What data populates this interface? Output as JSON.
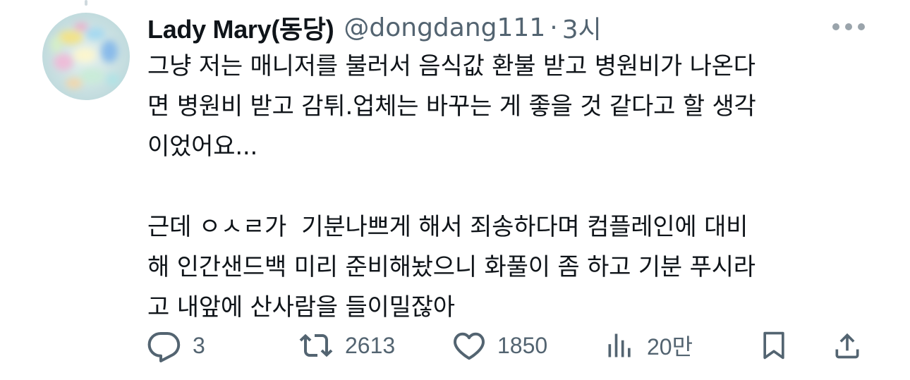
{
  "tweet": {
    "author_name": "Lady Mary(동당)",
    "handle": "@dongdang111",
    "separator": "·",
    "time": "3시",
    "text": "그냥 저는 매니저를 불러서 음식값 환불 받고 병원비가 나온다\n면 병원비 받고 감튀.업체는 바꾸는 게 좋을 것 같다고 할 생각\n이었어요...\n\n근데 ㅇㅅㄹ가  기분나쁘게 해서 죄송하다며 컴플레인에 대비\n해 인간샌드백 미리 준비해놨으니 화풀이 좀 하고 기분 푸시라\n고 내앞에 산사람을 들이밀잖아"
  },
  "actions": {
    "reply_count": "3",
    "retweet_count": "2613",
    "like_count": "1850",
    "views_count": "20만"
  },
  "icons": {
    "more": "more-horizontal-icon",
    "reply": "reply-bubble-icon",
    "retweet": "retweet-icon",
    "like": "heart-icon",
    "views": "views-chart-icon",
    "bookmark": "bookmark-icon",
    "share": "share-icon"
  },
  "colors": {
    "text": "#0f1419",
    "secondary": "#536471"
  }
}
